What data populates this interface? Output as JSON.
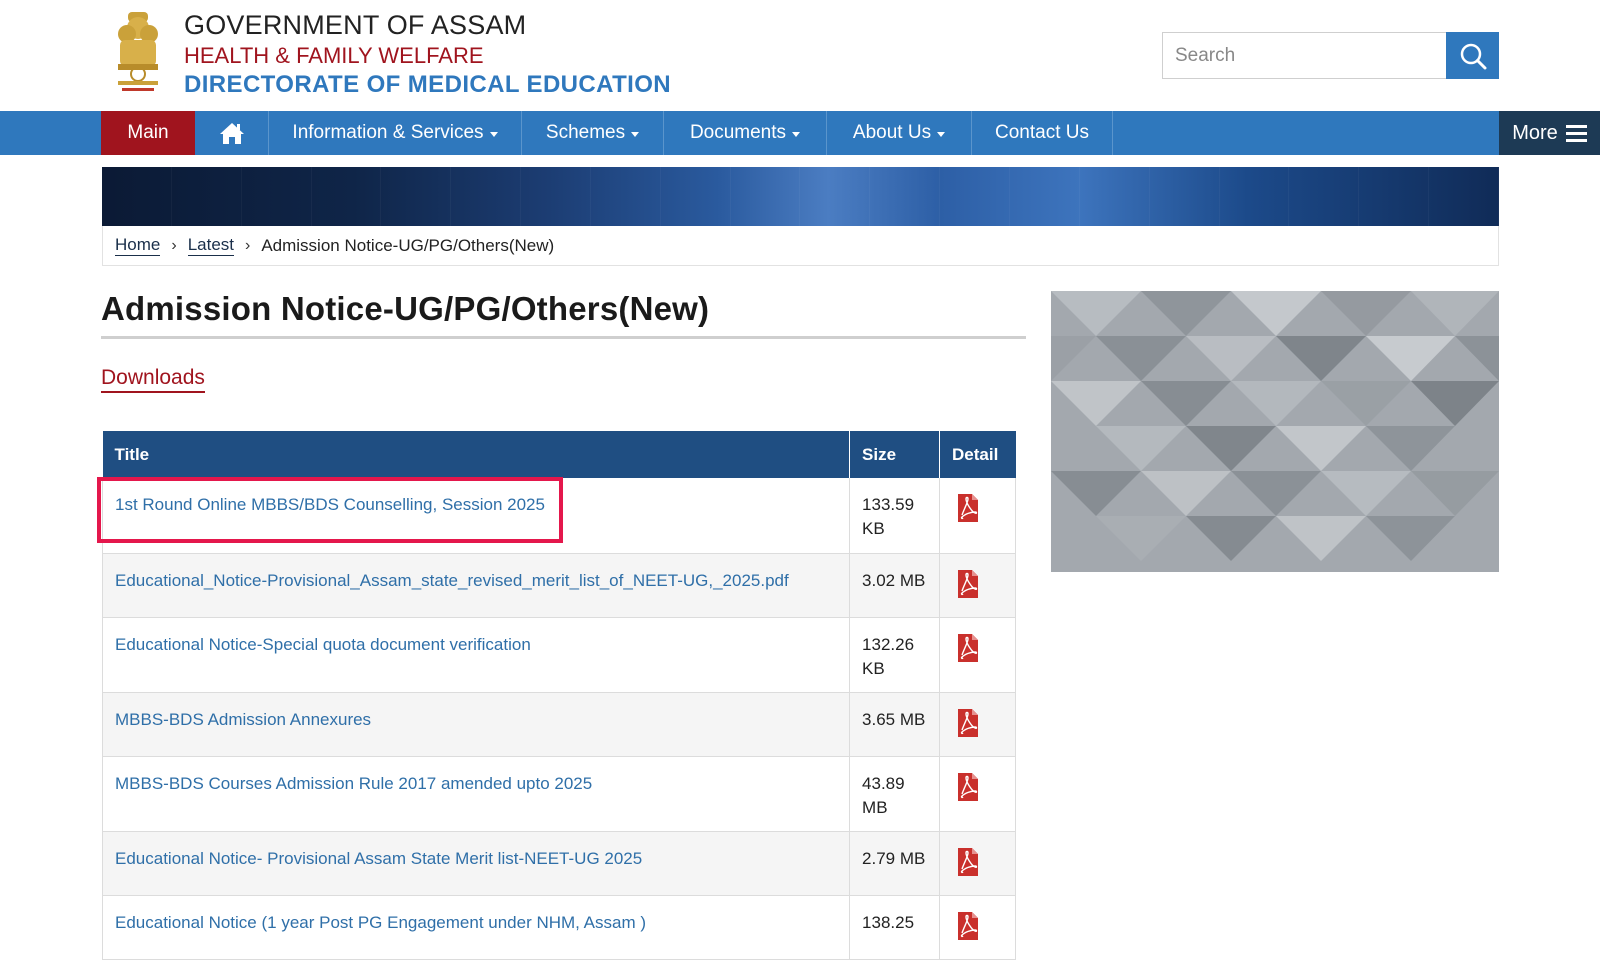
{
  "header": {
    "org_line1": "GOVERNMENT OF ASSAM",
    "org_line2": "HEALTH & FAMILY WELFARE",
    "org_line3": "DIRECTORATE OF MEDICAL EDUCATION",
    "search_placeholder": "Search"
  },
  "nav": {
    "main": "Main",
    "info": "Information & Services",
    "schemes": "Schemes",
    "documents": "Documents",
    "about": "About Us",
    "contact": "Contact Us",
    "more": "More"
  },
  "breadcrumb": {
    "home": "Home",
    "latest": "Latest",
    "current": "Admission Notice-UG/PG/Others(New)"
  },
  "page": {
    "title": "Admission Notice-UG/PG/Others(New)",
    "section": "Downloads"
  },
  "table": {
    "headers": {
      "title": "Title",
      "size": "Size",
      "detail": "Detail"
    },
    "rows": [
      {
        "title": "1st Round Online MBBS/BDS Counselling, Session 2025",
        "size": "133.59 KB"
      },
      {
        "title": "Educational_Notice-Provisional_Assam_state_revised_merit_list_of_NEET-UG,_2025.pdf",
        "size": "3.02 MB"
      },
      {
        "title": "Educational Notice-Special quota document verification",
        "size": "132.26 KB"
      },
      {
        "title": "MBBS-BDS Admission Annexures",
        "size": "3.65 MB"
      },
      {
        "title": "MBBS-BDS Courses Admission Rule 2017 amended upto 2025",
        "size": "43.89 MB"
      },
      {
        "title": "Educational Notice- Provisional Assam State Merit list-NEET-UG 2025",
        "size": "2.79 MB"
      },
      {
        "title": "Educational Notice (1 year Post PG Engagement under NHM, Assam )",
        "size": "138.25"
      }
    ]
  },
  "colors": {
    "nav_blue": "#2f78bd",
    "brand_red": "#a0141e",
    "table_header": "#1f4e82",
    "highlight": "#e4174c"
  }
}
